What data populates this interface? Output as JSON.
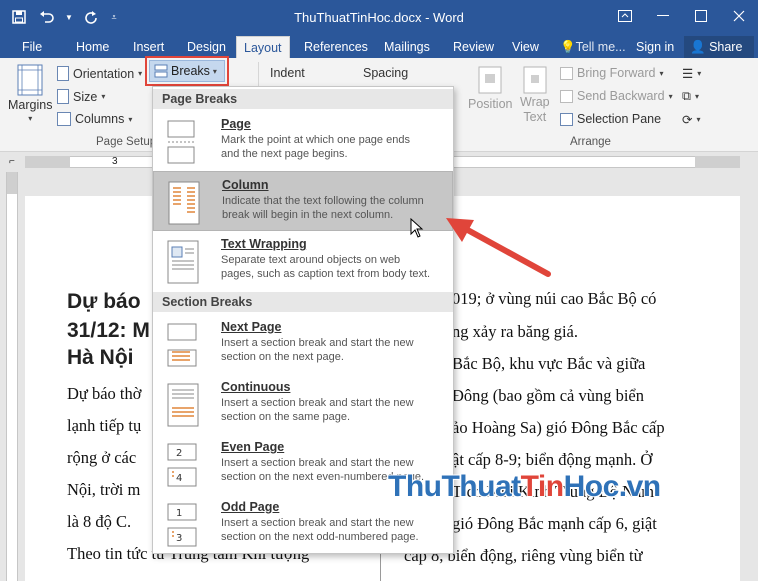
{
  "app": {
    "doc_title": "ThuThuatTinHoc.docx - Word",
    "share": "Share",
    "sign_in": "Sign in",
    "tell_me": "Tell me..."
  },
  "tabs": [
    "File",
    "Home",
    "Insert",
    "Design",
    "Layout",
    "References",
    "Mailings",
    "Review",
    "View"
  ],
  "ribbon": {
    "margins": "Margins",
    "orientation": "Orientation",
    "size": "Size",
    "columns": "Columns",
    "breaks": "Breaks",
    "page_setup": "Page Setup",
    "indent": "Indent",
    "spacing": "Spacing",
    "position": "Position",
    "wrap_text_1": "Wrap",
    "wrap_text_2": "Text",
    "bring_forward": "Bring Forward",
    "send_backward": "Send Backward",
    "selection_pane": "Selection Pane",
    "arrange": "Arrange"
  },
  "ruler": {
    "tick_label": "3"
  },
  "menu": {
    "page_breaks_header": "Page Breaks",
    "section_breaks_header": "Section Breaks",
    "items": [
      {
        "title": "Page",
        "desc1": "Mark the point at which one page ends",
        "desc2": "and the next page begins."
      },
      {
        "title": "Column",
        "desc1": "Indicate that the text following the column",
        "desc2": "break will begin in the next column."
      },
      {
        "title": "Text Wrapping",
        "desc1": "Separate text around objects on web",
        "desc2": "pages, such as caption text from body text."
      },
      {
        "title": "Next Page",
        "desc1": "Insert a section break and start the new",
        "desc2": "section on the next page."
      },
      {
        "title": "Continuous",
        "desc1": "Insert a section break and start the new",
        "desc2": "section on the same page."
      },
      {
        "title": "Even Page",
        "desc1": "Insert a section break and start the new",
        "desc2": "section on the next even-numbered page."
      },
      {
        "title": "Odd Page",
        "desc1": "Insert a section break and start the new",
        "desc2": "section on the next odd-numbered page."
      }
    ]
  },
  "document": {
    "heading_lines": [
      "Dự báo",
      "31/12: M",
      "Hà Nội"
    ],
    "left_lines": [
      "Dự báo thờ",
      "lạnh tiếp tụ",
      "rộng ở các",
      "Nội, trời m",
      "là 8 độ C.",
      "Theo tin tức từ Trung tâm Khí tượng"
    ],
    "right_lines": [
      "019; ở vùng núi cao Bắc Bộ có",
      "ng xảy ra băng giá.",
      "Bắc Bộ, khu vực Bắc và giữa",
      "Đông (bao gồm cả vùng biển",
      "ảo Hoàng Sa) gió Đông Bắc cấp",
      "ật cấp 8-9; biển động mạnh. Ở",
      "Tích  Mũi  Kinh  Trung  Bộ  Nam",
      "gió Đông Bắc mạnh cấp 6, giật",
      "cấp 8, biển động, riêng vùng biển từ"
    ]
  },
  "watermark": {
    "p1": "Thu",
    "p2": "Thuat",
    "p3": "Tin",
    "p4": "Hoc",
    "p5": ".vn"
  },
  "colors": {
    "accent": "#2b579a",
    "highlight_box": "#e0453a",
    "arrow": "#e0453a"
  }
}
